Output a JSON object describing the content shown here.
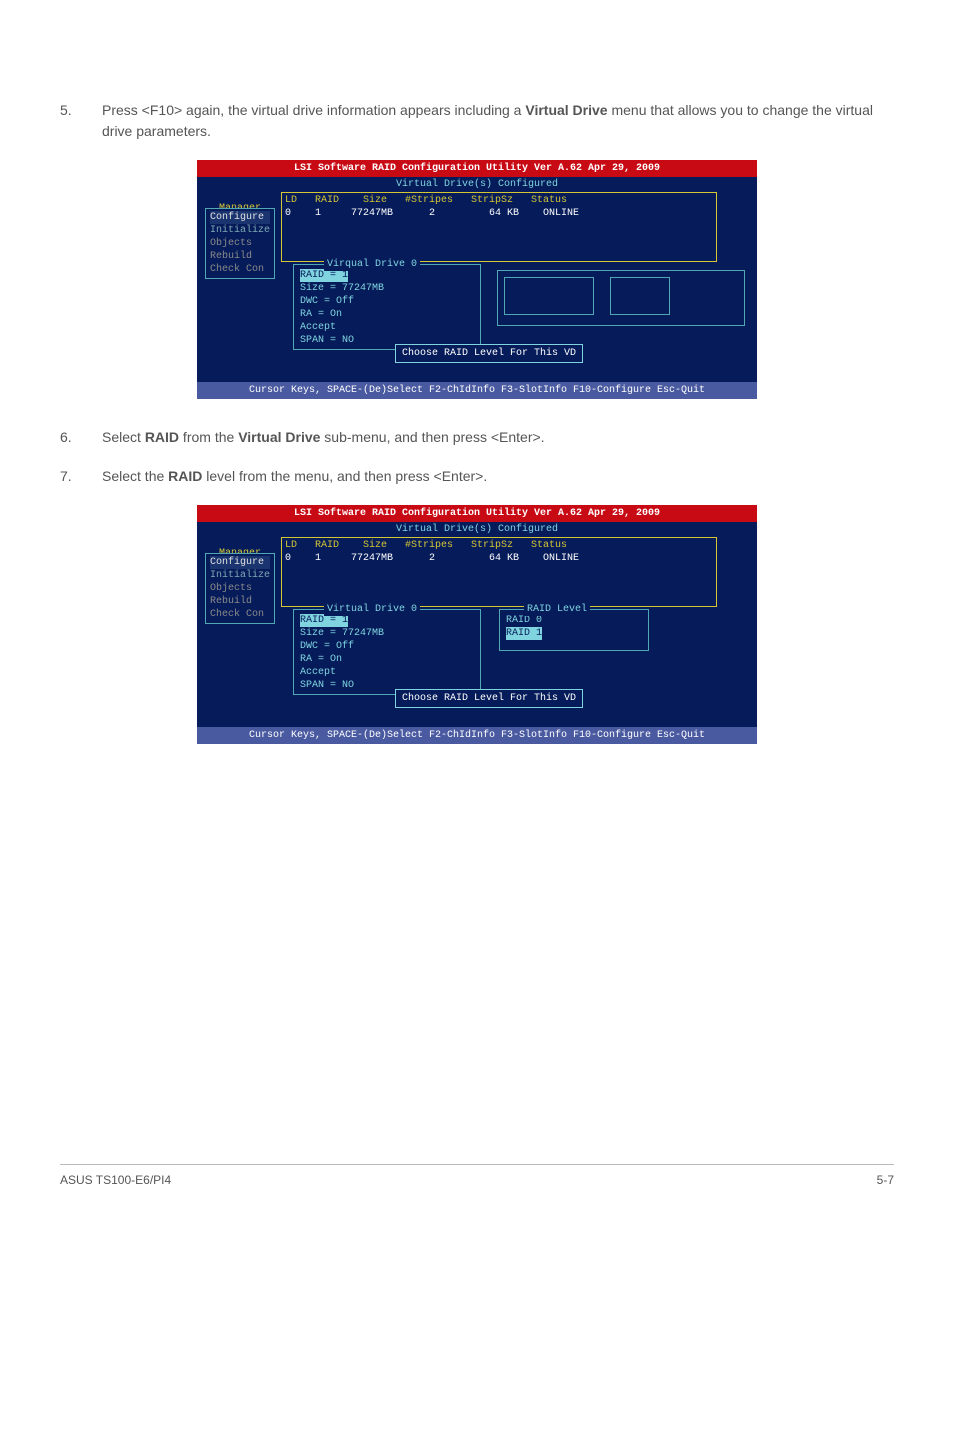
{
  "steps": {
    "s5": {
      "num": "5.",
      "prefix": "Press <F10> again, the virtual drive information appears including a ",
      "bold1": "Virtual Drive",
      "suffix": " menu that allows you to change the virtual drive parameters."
    },
    "s6": {
      "num": "6.",
      "prefix": "Select ",
      "bold1": "RAID",
      "mid": " from the ",
      "bold2": "Virtual Drive",
      "suffix": " sub-menu, and then press <Enter>."
    },
    "s7": {
      "num": "7.",
      "prefix": "Select the ",
      "bold1": "RAID",
      "suffix": " level from the menu, and then press <Enter>."
    }
  },
  "bios": {
    "title": "LSI Software RAID Configuration Utility Ver A.62 Apr 29, 2009",
    "subtitle": "Virtual Drive(s) Configured",
    "header_row": "LD   RAID    Size   #Stripes   StripSz   Status",
    "data_row": "0    1     77247MB      2         64 KB    ONLINE",
    "sidebar_label": "Manager",
    "menu": {
      "configure": "Configure",
      "initialize": "Initialize",
      "objects": "Objects",
      "rebuild": "Rebuild",
      "check": "Check Con"
    },
    "vd_title_1": "Virqual Drive 0",
    "vd_title_2": "Virtual Drive 0",
    "vd": {
      "raid": "RAID = 1",
      "size": "Size = 77247MB",
      "dwc": "DWC  = Off",
      "ra": "RA   = On",
      "accept": "Accept",
      "span": "SPAN = NO"
    },
    "raid_level_title": "RAID Level",
    "raid_level": {
      "r0": "RAID 0",
      "r1": "RAID 1"
    },
    "choose": "Choose RAID Level For This VD",
    "footer": "Cursor Keys, SPACE-(De)Select F2-ChIdInfo F3-SlotInfo F10-Configure Esc-Quit"
  },
  "page_footer": {
    "left": "ASUS TS100-E6/PI4",
    "right": "5-7"
  }
}
